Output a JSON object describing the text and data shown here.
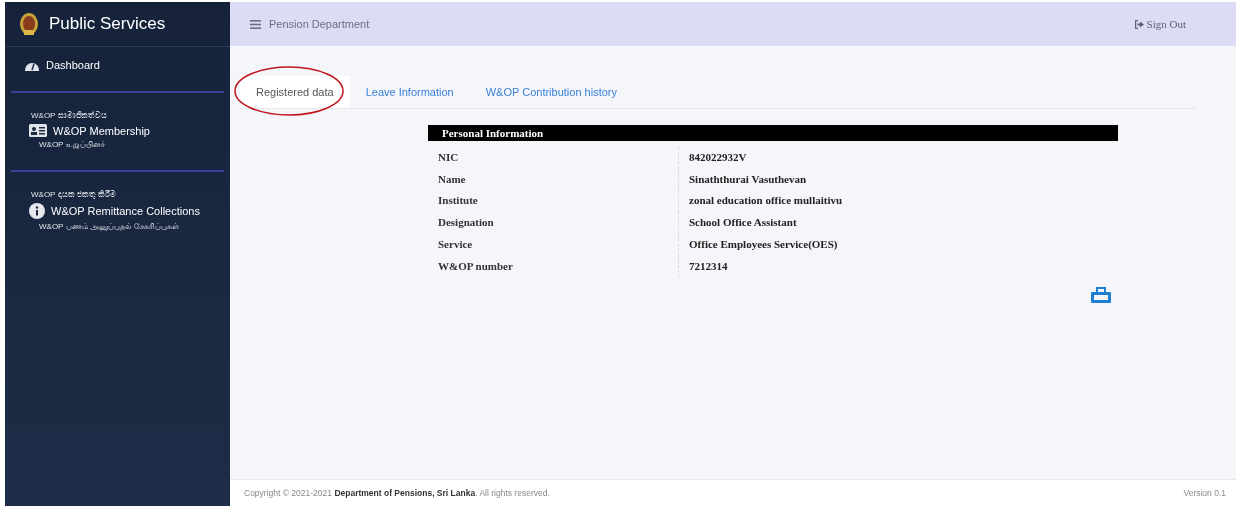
{
  "sidebar": {
    "brand": "Public Services",
    "items": [
      {
        "kind": "link",
        "label": "Dashboard"
      },
      {
        "kind": "multilang",
        "sinhala": "W&OP සාමාජිකත්වය",
        "label": "W&OP Membership",
        "tamil": "W&OP உறுப்பினர்"
      },
      {
        "kind": "multilang",
        "sinhala": "W&OP දායක එකතු කිරීම",
        "label": "W&OP Remittance Collections",
        "tamil": "W&OP பணம் அனுப்புதல் சேகரிப்புகள்"
      }
    ]
  },
  "header": {
    "title": "Pension Department",
    "sign_out": "Sign Out"
  },
  "tabs": [
    {
      "label": "Registered data",
      "selected": true,
      "circled": true
    },
    {
      "label": "Leave Information",
      "selected": false,
      "circled": false
    },
    {
      "label": "W&OP Contribution history",
      "selected": false,
      "circled": false
    }
  ],
  "personal_info": {
    "title": "Personal Information",
    "rows": [
      {
        "label": "NIC",
        "value": "842022932V"
      },
      {
        "label": "Name",
        "value": "Sinaththurai Vasuthevan"
      },
      {
        "label": "Institute",
        "value": "zonal education office mullaitivu"
      },
      {
        "label": "Designation",
        "value": "School Office Assistant"
      },
      {
        "label": "Service",
        "value": "Office Employees Service(OES)"
      },
      {
        "label": "W&OP number",
        "value": "7212314"
      }
    ]
  },
  "footer": {
    "copyright": "Copyright © 2021-2021 **Department of Pensions, Sri Lanka**. All rights reserved.",
    "version": "Version 0.1"
  }
}
